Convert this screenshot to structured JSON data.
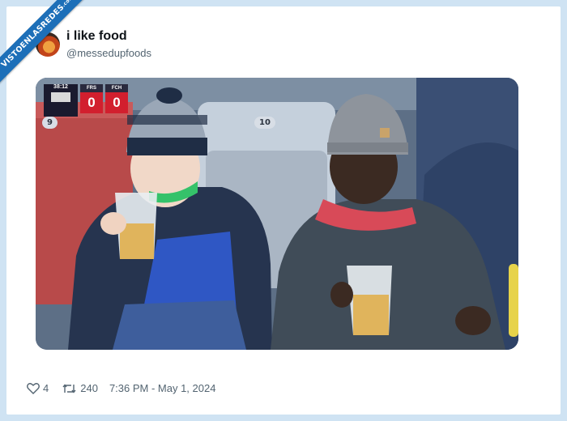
{
  "watermark": {
    "text": "VISTOENLASREDES",
    "suffix": ".com"
  },
  "tweet": {
    "display_name": "i like food",
    "handle": "@messedupfoods",
    "likes": "4",
    "retweets": "240",
    "timestamp": "7:36 PM - May 1, 2024"
  },
  "photo": {
    "scoreboard": {
      "clock": "38:12",
      "home_team": "FRS",
      "away_team": "FCH",
      "home_score": "0",
      "away_score": "0"
    },
    "seat_labels": [
      "9",
      "10"
    ]
  },
  "colors": {
    "ribbon": "#1d6fb8",
    "background": "#cfe3f3",
    "score_red": "#d21f2e"
  },
  "icons": [
    "heart-icon",
    "retweet-icon"
  ]
}
